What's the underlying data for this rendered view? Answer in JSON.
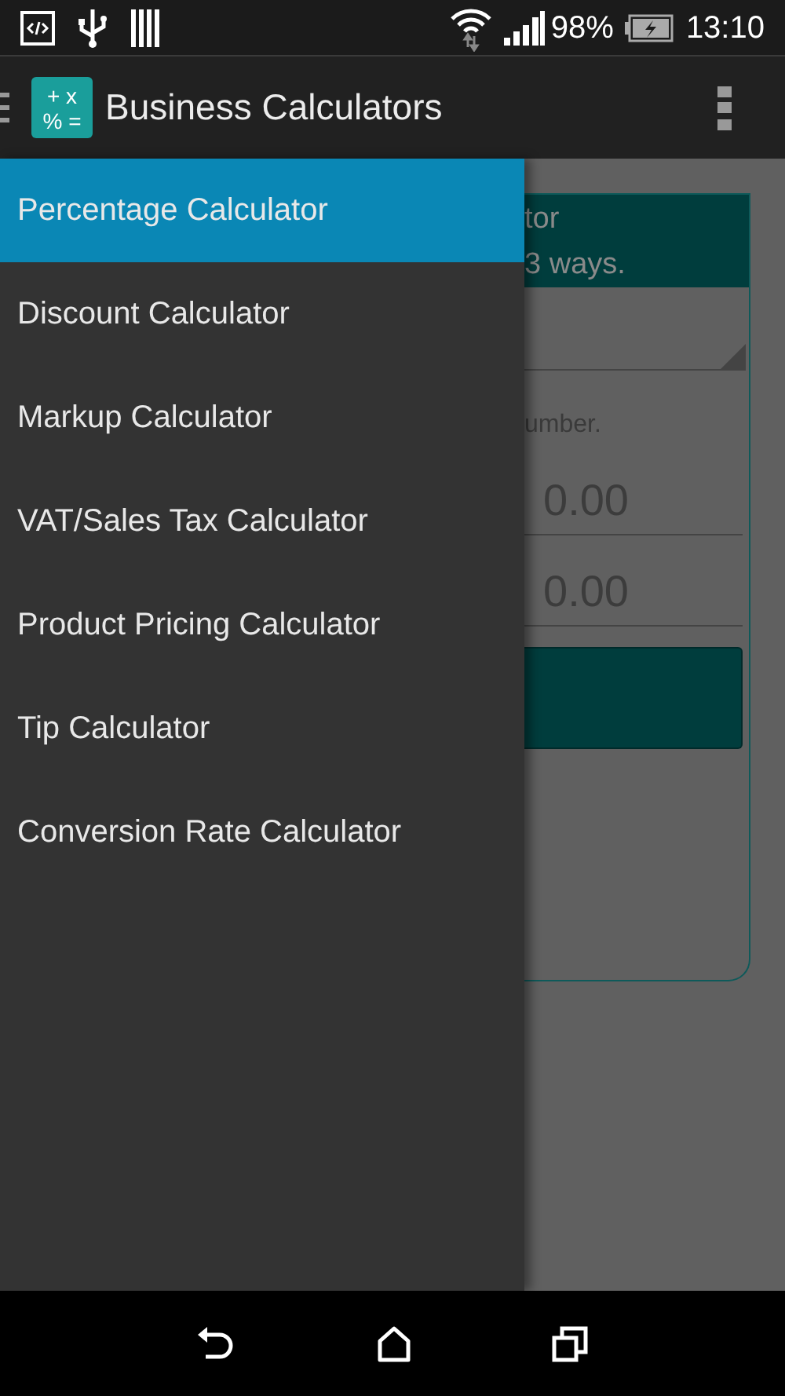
{
  "status_bar": {
    "battery": "98%",
    "time": "13:10"
  },
  "app_bar": {
    "title": "Business Calculators",
    "logo_top": "+ x",
    "logo_bottom": "% ="
  },
  "drawer": {
    "items": [
      {
        "label": "Percentage Calculator",
        "selected": true
      },
      {
        "label": "Discount Calculator",
        "selected": false
      },
      {
        "label": "Markup Calculator",
        "selected": false
      },
      {
        "label": "VAT/Sales Tax Calculator",
        "selected": false
      },
      {
        "label": "Product Pricing Calculator",
        "selected": false
      },
      {
        "label": "Tip Calculator",
        "selected": false
      },
      {
        "label": "Conversion Rate Calculator",
        "selected": false
      }
    ]
  },
  "background_card": {
    "title": "tor",
    "subtitle": "3 ways.",
    "hint": "umber.",
    "fields": [
      {
        "value": "0.00"
      },
      {
        "value": "0.00"
      }
    ]
  }
}
